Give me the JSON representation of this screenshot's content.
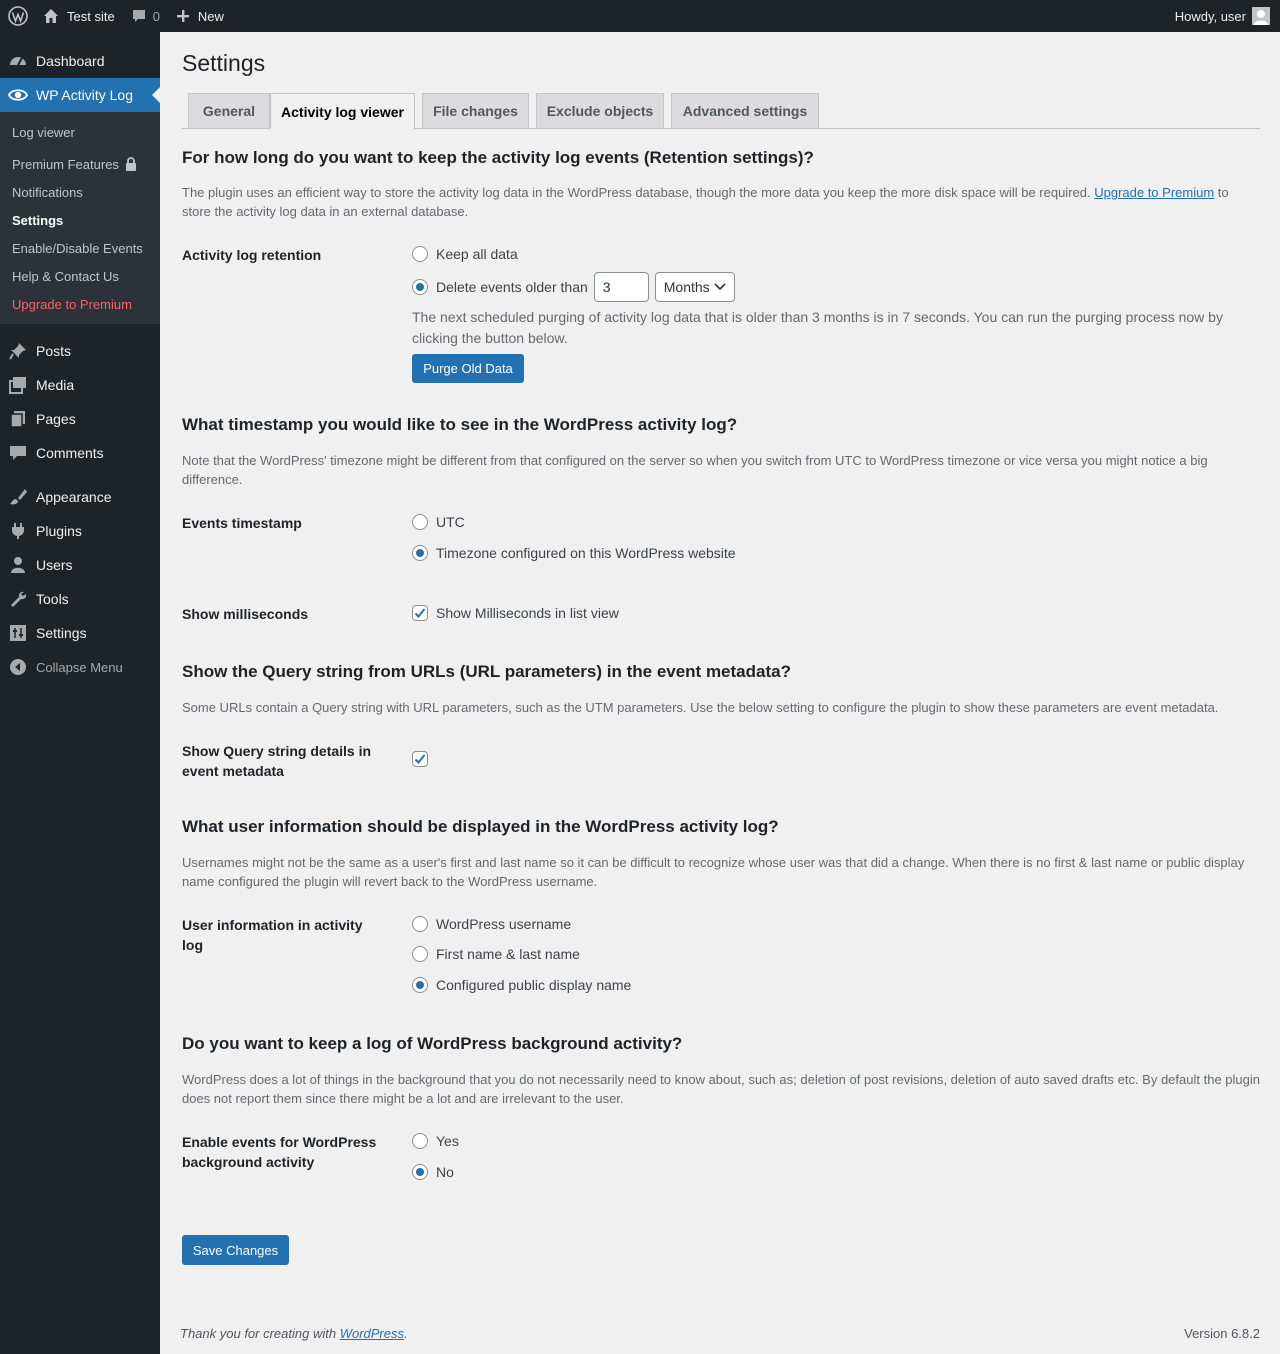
{
  "admin_bar": {
    "site_name": "Test site",
    "comments_count": "0",
    "new_label": "New",
    "howdy": "Howdy, user"
  },
  "sidebar": {
    "dashboard": "Dashboard",
    "plugin": "WP Activity Log",
    "submenu": {
      "log_viewer": "Log viewer",
      "premium_features": "Premium Features",
      "notifications": "Notifications",
      "settings": "Settings",
      "enable_disable": "Enable/Disable Events",
      "help": "Help & Contact Us",
      "upgrade": "Upgrade to Premium"
    },
    "posts": "Posts",
    "media": "Media",
    "pages": "Pages",
    "comments": "Comments",
    "appearance": "Appearance",
    "plugins": "Plugins",
    "users": "Users",
    "tools": "Tools",
    "settings": "Settings",
    "collapse": "Collapse Menu"
  },
  "page": {
    "title": "Settings",
    "tabs": [
      "General",
      "Activity log viewer",
      "File changes",
      "Exclude objects",
      "Advanced settings"
    ],
    "active_tab": "Activity log viewer"
  },
  "retention": {
    "heading": "For how long do you want to keep the activity log events (Retention settings)?",
    "desc_before": "The plugin uses an efficient way to store the activity log data in the WordPress database, though the more data you keep the more disk space will be required. ",
    "desc_link": "Upgrade to Premium",
    "desc_after": " to store the activity log data in an external database.",
    "label": "Activity log retention",
    "option_keep": "Keep all data",
    "option_delete": "Delete events older than",
    "value": "3",
    "unit": "Months",
    "note": "The next scheduled purging of activity log data that is older than 3 months is in 7 seconds. You can run the purging process now by clicking the button below.",
    "purge_button": "Purge Old Data"
  },
  "timestamp": {
    "heading": "What timestamp you would like to see in the WordPress activity log?",
    "desc": "Note that the WordPress' timezone might be different from that configured on the server so when you switch from UTC to WordPress timezone or vice versa you might notice a big difference.",
    "label": "Events timestamp",
    "option_utc": "UTC",
    "option_tz": "Timezone configured on this WordPress website",
    "ms_label": "Show milliseconds",
    "ms_option": "Show Milliseconds in list view"
  },
  "query": {
    "heading": "Show the Query string from URLs (URL parameters) in the event metadata?",
    "desc": "Some URLs contain a Query string with URL parameters, such as the UTM parameters. Use the below setting to configure the plugin to show these parameters are event metadata.",
    "label": "Show Query string details in event metadata"
  },
  "userinfo": {
    "heading": "What user information should be displayed in the WordPress activity log?",
    "desc": "Usernames might not be the same as a user's first and last name so it can be difficult to recognize whose user was that did a change. When there is no first & last name or public display name configured the plugin will revert back to the WordPress username.",
    "label": "User information in activity log",
    "option_username": "WordPress username",
    "option_name": "First name & last name",
    "option_display": "Configured public display name"
  },
  "background": {
    "heading": "Do you want to keep a log of WordPress background activity?",
    "desc": "WordPress does a lot of things in the background that you do not necessarily need to know about, such as; deletion of post revisions, deletion of auto saved drafts etc. By default the plugin does not report them since there might be a lot and are irrelevant to the user.",
    "label": "Enable events for WordPress background activity",
    "option_yes": "Yes",
    "option_no": "No"
  },
  "save_button": "Save Changes",
  "footer": {
    "thanks_before": "Thank you for creating with ",
    "thanks_link": "WordPress",
    "thanks_after": ".",
    "version": "Version 6.8.2"
  },
  "colors": {
    "accent": "#2271b1",
    "admin_dark": "#1d2327",
    "upgrade": "#f86368"
  }
}
